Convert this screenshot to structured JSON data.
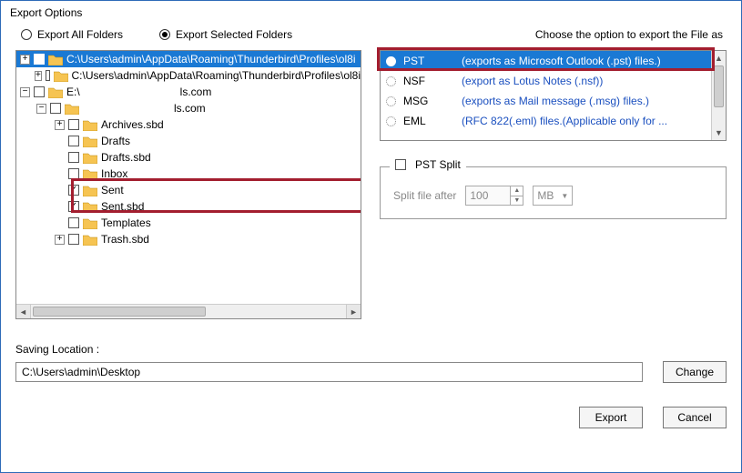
{
  "window": {
    "title": "Export Options"
  },
  "mode": {
    "all_label": "Export All Folders",
    "selected_label": "Export Selected Folders",
    "value": "selected"
  },
  "tree": {
    "root1": {
      "label": "C:\\Users\\admin\\AppData\\Roaming\\Thunderbird\\Profiles\\ol8i",
      "expanded": true,
      "checked": false
    },
    "root1_child": {
      "label": "C:\\Users\\admin\\AppData\\Roaming\\Thunderbird\\Profiles\\ol8i",
      "expanded": true,
      "checked": false
    },
    "root2": {
      "prefix": "E:\\",
      "suffix": "ls.com",
      "expanded": true,
      "checked": false
    },
    "root2_child": {
      "suffix": "ls.com",
      "expanded": true,
      "checked": false
    },
    "items": [
      {
        "label": "Archives.sbd",
        "checked": false,
        "expander": "plus"
      },
      {
        "label": "Drafts",
        "checked": false,
        "expander": "none"
      },
      {
        "label": "Drafts.sbd",
        "checked": false,
        "expander": "none"
      },
      {
        "label": "Inbox",
        "checked": false,
        "expander": "none"
      },
      {
        "label": "Sent",
        "checked": true,
        "expander": "none"
      },
      {
        "label": "Sent.sbd",
        "checked": true,
        "expander": "none"
      },
      {
        "label": "Templates",
        "checked": false,
        "expander": "none"
      },
      {
        "label": "Trash.sbd",
        "checked": false,
        "expander": "plus"
      }
    ]
  },
  "format": {
    "heading": "Choose the option to export the File as",
    "options": [
      {
        "name": "PST",
        "desc": "(exports as Microsoft Outlook (.pst) files.)",
        "selected": true
      },
      {
        "name": "NSF",
        "desc": "(export as Lotus Notes (.nsf))",
        "selected": false
      },
      {
        "name": "MSG",
        "desc": "(exports as Mail message (.msg) files.)",
        "selected": false
      },
      {
        "name": "EML",
        "desc": "(RFC 822(.eml) files.(Applicable only for ...",
        "selected": false
      }
    ]
  },
  "split": {
    "legend": "PST Split",
    "label": "Split file after",
    "value": "100",
    "unit": "MB",
    "enabled": false
  },
  "saving": {
    "label": "Saving Location :",
    "path": "C:\\Users\\admin\\Desktop",
    "change_label": "Change"
  },
  "buttons": {
    "export": "Export",
    "cancel": "Cancel"
  }
}
